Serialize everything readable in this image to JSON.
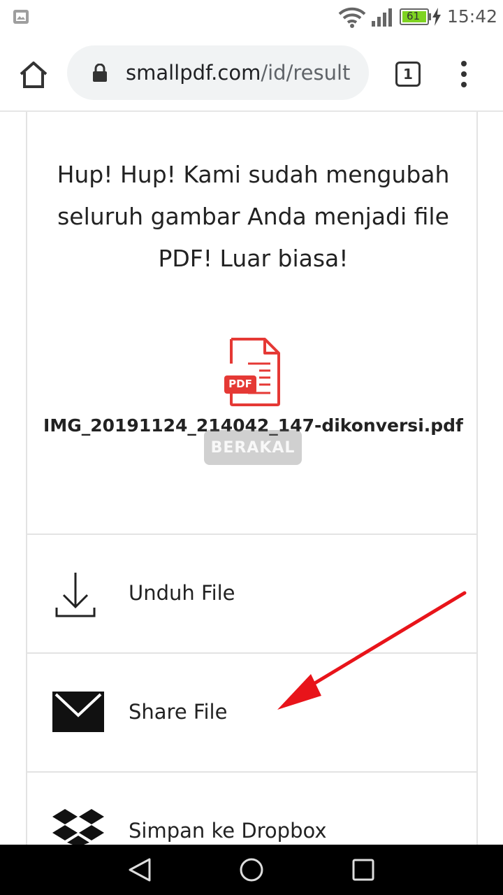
{
  "status_bar": {
    "battery_level": "61",
    "time": "15:42"
  },
  "browser": {
    "url_host": "smallpdf.com",
    "url_path": "/id/result",
    "tab_count": "1"
  },
  "result": {
    "headline": "Hup! Hup! Kami sudah mengubah seluruh gambar Anda menjadi file PDF! Luar biasa!",
    "pdf_badge": "PDF",
    "file_name": "IMG_20191124_214042_147-dikonversi.pdf",
    "watermark": "BERAKAL"
  },
  "actions": [
    {
      "label": "Unduh File",
      "icon": "download-icon"
    },
    {
      "label": "Share File",
      "icon": "envelope-icon"
    },
    {
      "label": "Simpan ke Dropbox",
      "icon": "dropbox-icon"
    }
  ],
  "colors": {
    "pdf_red": "#e53935",
    "arrow_red": "#e8141a",
    "divider": "#e3e3e3",
    "battery_green": "#7ed321"
  }
}
